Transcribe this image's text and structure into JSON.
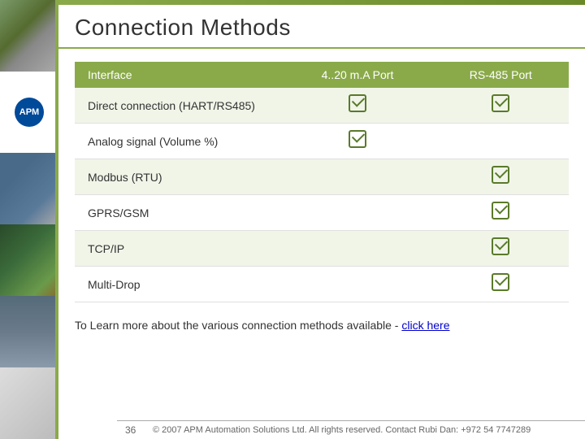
{
  "title": "Connection Methods",
  "sidebar": {
    "logo_text": "APM"
  },
  "table": {
    "headers": {
      "col1": "Interface",
      "col2": "4..20 m.A Port",
      "col3": "RS-485 Port"
    },
    "rows": [
      {
        "interface": "Direct connection (HART/RS485)",
        "col2_check": true,
        "col3_check": true
      },
      {
        "interface": "Analog signal (Volume %)",
        "col2_check": true,
        "col3_check": false
      },
      {
        "interface": "Modbus (RTU)",
        "col2_check": false,
        "col3_check": true
      },
      {
        "interface": "GPRS/GSM",
        "col2_check": false,
        "col3_check": true
      },
      {
        "interface": "TCP/IP",
        "col2_check": false,
        "col3_check": true
      },
      {
        "interface": "Multi-Drop",
        "col2_check": false,
        "col3_check": true
      }
    ]
  },
  "footer_text_prefix": "To Learn more about the various connection methods available -",
  "footer_link": "click here",
  "page_number": "36",
  "copyright": "© 2007 APM Automation Solutions Ltd. All rights reserved. Contact Rubi Dan:  +972 54 7747289"
}
